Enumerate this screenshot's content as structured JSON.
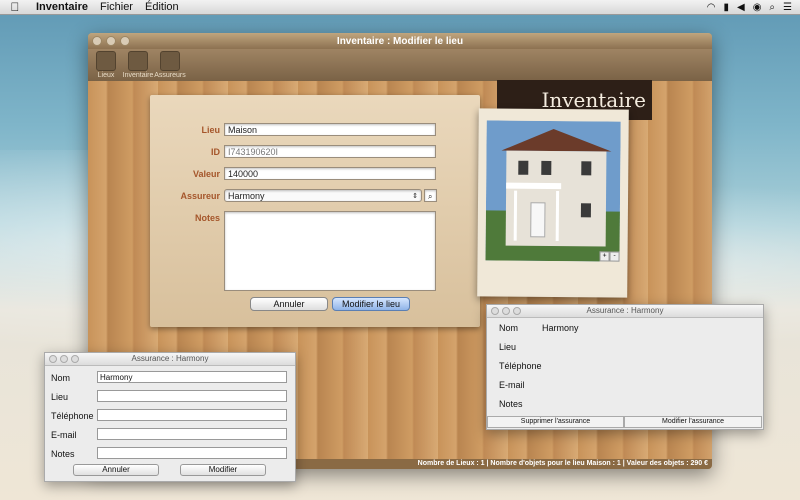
{
  "menubar": {
    "app": "Inventaire",
    "menus": [
      "Fichier",
      "Édition"
    ]
  },
  "main_window": {
    "title": "Inventaire : Modifier le lieu",
    "toolbar": [
      "Lieux",
      "Inventaire",
      "Assureurs"
    ],
    "logo": "Inventaire",
    "form": {
      "lieu_label": "Lieu",
      "lieu_value": "Maison",
      "id_label": "ID",
      "id_value": "I743190620I",
      "valeur_label": "Valeur",
      "valeur_value": "140000",
      "assureur_label": "Assureur",
      "assureur_value": "Harmony",
      "notes_label": "Notes",
      "notes_value": "",
      "cancel": "Annuler",
      "submit": "Modifier le lieu"
    },
    "status": "Nombre de Lieux : 1 | Nombre d'objets pour le lieu Maison : 1 | Valeur des objets : 290 €"
  },
  "edit_palette": {
    "title": "Assurance : Harmony",
    "nom_label": "Nom",
    "nom_value": "Harmony",
    "lieu_label": "Lieu",
    "lieu_value": "",
    "tel_label": "Téléphone",
    "tel_value": "",
    "email_label": "E-mail",
    "email_value": "",
    "notes_label": "Notes",
    "notes_value": "",
    "cancel": "Annuler",
    "submit": "Modifier"
  },
  "view_palette": {
    "title": "Assurance : Harmony",
    "nom_label": "Nom",
    "nom_value": "Harmony",
    "lieu_label": "Lieu",
    "tel_label": "Téléphone",
    "email_label": "E-mail",
    "notes_label": "Notes",
    "delete": "Supprimer l'assurance",
    "edit": "Modifier l'assurance"
  },
  "colors": {
    "label": "#a5562b",
    "wood": "#c8935a"
  }
}
